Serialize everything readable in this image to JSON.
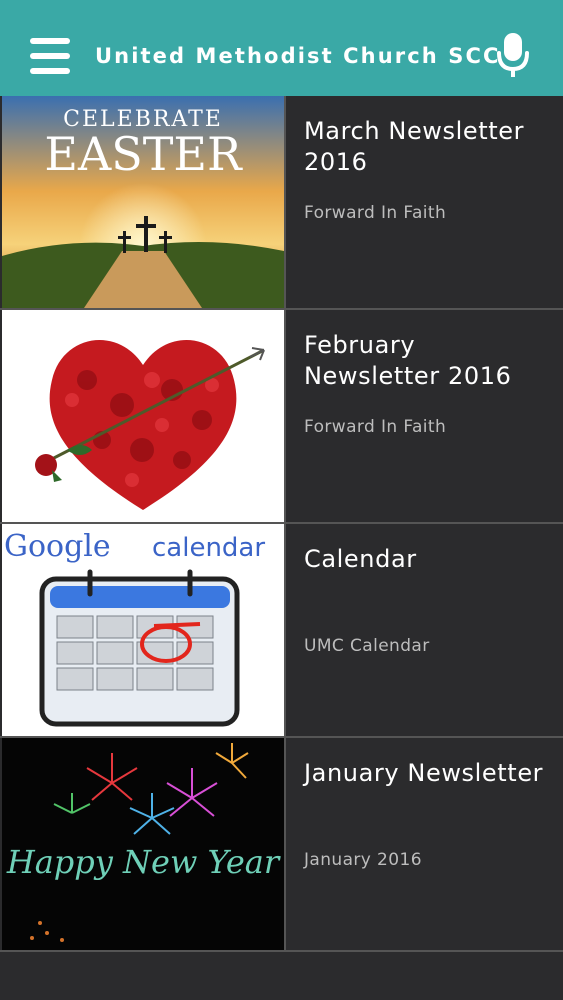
{
  "appbar": {
    "title": "United Methodist Church SCC",
    "menu_icon": "hamburger-menu-icon",
    "mic_icon": "microphone-icon",
    "color": "#3aa9a6"
  },
  "items": [
    {
      "title": "March Newsletter 2016",
      "subtitle": "Forward In Faith",
      "image_text_1": "CELEBRATE",
      "image_text_2": "EASTER"
    },
    {
      "title": "February Newsletter 2016",
      "subtitle": "Forward In Faith"
    },
    {
      "title": "Calendar",
      "subtitle": "UMC Calendar",
      "image_text_1": "Google",
      "image_text_2": "calendar"
    },
    {
      "title": "January Newsletter",
      "subtitle": "January 2016",
      "image_text_1": "Happy New Year"
    }
  ]
}
